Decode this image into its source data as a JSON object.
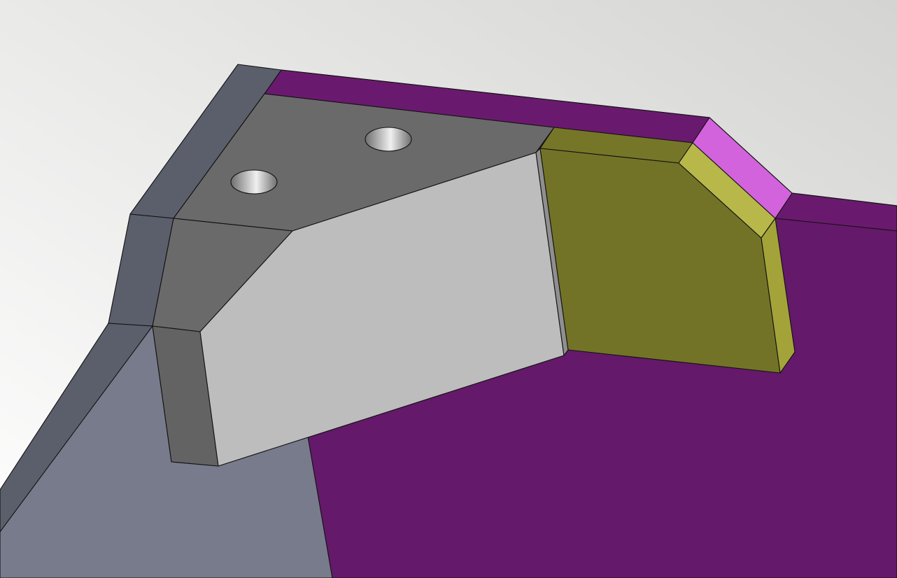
{
  "viewport": {
    "background_light": "#ffffff",
    "background_dark": "#d4d4d2"
  },
  "model": {
    "faces": {
      "base_plate_top": "#64196a",
      "base_plate_back_rim": "#6a1a6e",
      "gray_plate_top": "#787b8c",
      "gray_plate_edge": "#5b5f6b",
      "bracket_top": "#6a6a6a",
      "bracket_side": "#636363",
      "bracket_front": "#bdbdbd",
      "bracket_sliver": "#8f8f8f",
      "olive_front": "#737328",
      "olive_top": "#767629",
      "olive_chamfer": "#b8b84a",
      "olive_right": "#a3a33a",
      "pink_chamfer": "#d263dc"
    },
    "features": {
      "holes": 2,
      "hole_colors": [
        "#6e6e6e",
        "#f0f0f0"
      ]
    }
  }
}
